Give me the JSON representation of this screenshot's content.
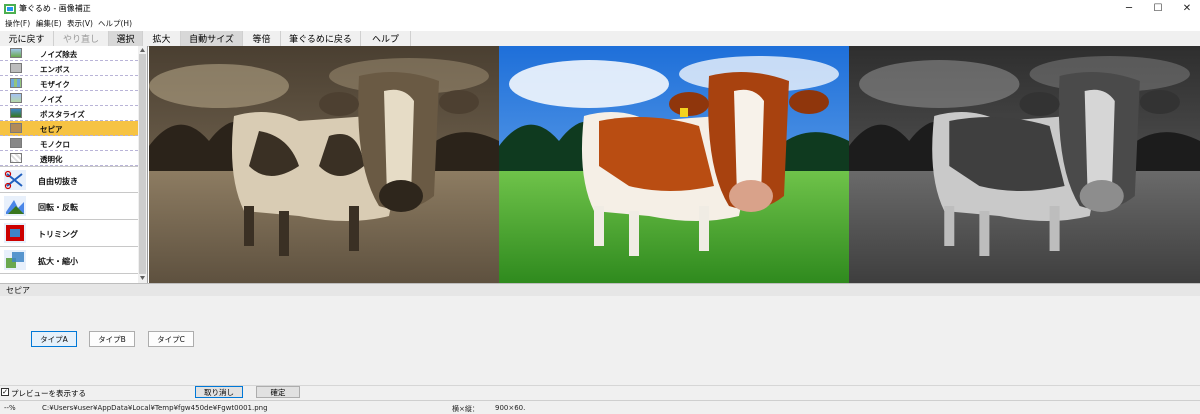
{
  "window": {
    "title": "筆ぐるめ - 画像補正",
    "minimize": "─",
    "maximize": "☐",
    "close": "✕"
  },
  "menu": [
    "操作(F)",
    "編集(E)",
    "表示(V)",
    "ヘルプ(H)"
  ],
  "toolbar": [
    "元に戻す",
    "やり直し",
    "選択",
    "拡大",
    "自動サイズ",
    "等倍",
    "筆ぐるめに戻る",
    "ヘルプ"
  ],
  "filters": [
    "ノイズ除去",
    "エンボス",
    "モザイク",
    "ノイズ",
    "ポスタライズ",
    "セピア",
    "モノクロ",
    "透明化"
  ],
  "selected_filter": "セピア",
  "tools": [
    "自由切抜き",
    "回転・反転",
    "トリミング",
    "拡大・縮小"
  ],
  "settings": {
    "title": "セピア",
    "types": [
      "タイプA",
      "タイプB",
      "タイプC"
    ],
    "selected_type": "タイプA"
  },
  "preview": {
    "checkbox_label": "プレビューを表示する",
    "checked": true
  },
  "actions": {
    "cancel": "取り消し",
    "ok": "確定"
  },
  "status": {
    "zoom": "--%",
    "path": "C:¥Users¥user¥AppData¥Local¥Temp¥fgw450de¥Fgwt0001.png",
    "size_label": "横×縦：",
    "size_value": "900×60."
  },
  "icons": {
    "app": "app-icon",
    "checkbox": "checkmark-icon"
  }
}
